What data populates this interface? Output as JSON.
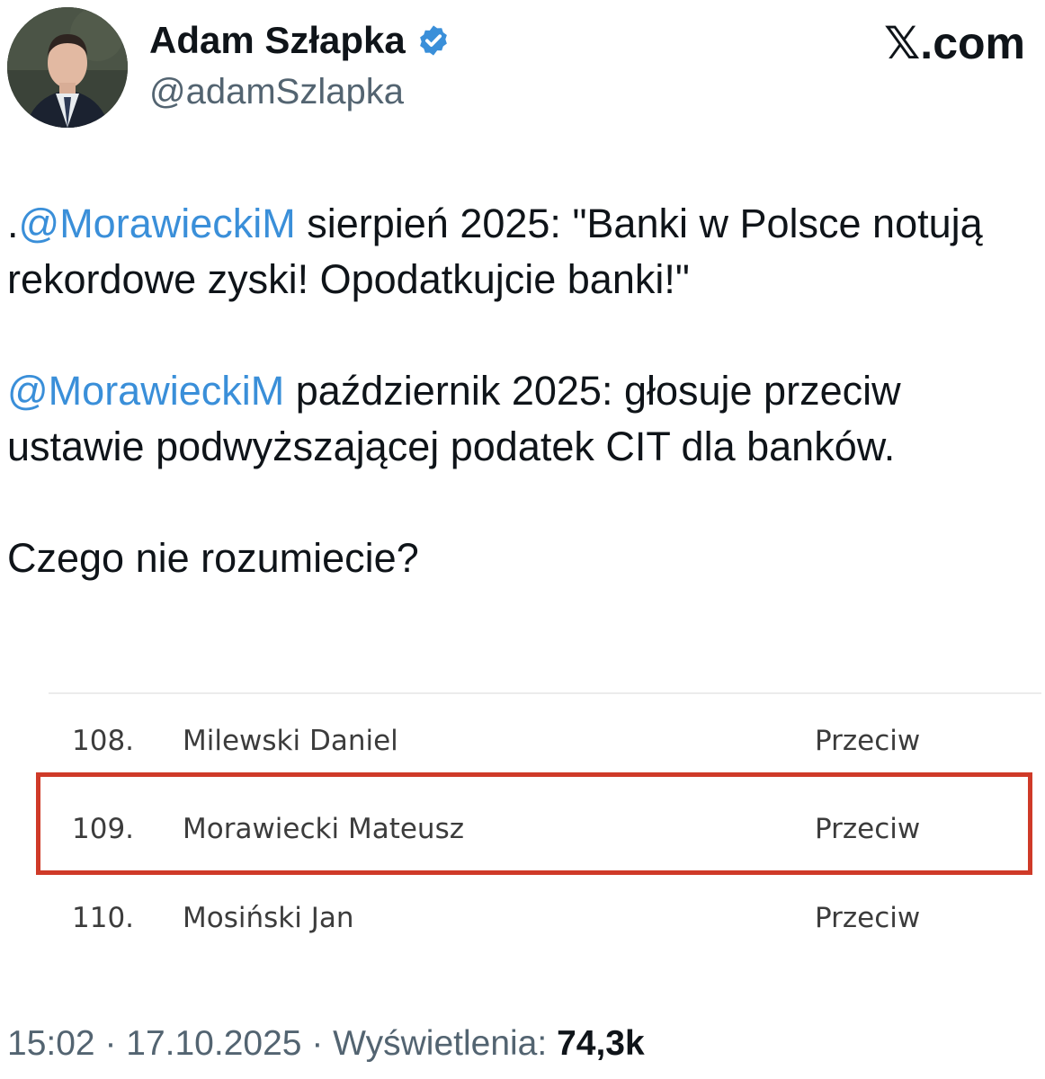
{
  "author": {
    "display_name": "Adam Szłapka",
    "handle": "@adamSzlapka",
    "verified": true,
    "avatar": "profile-photo"
  },
  "site_label": "𝕏.com",
  "tweet": {
    "paragraphs": [
      {
        "prefix": ".",
        "mention": "@MorawieckiM",
        "text": " sierpień 2025: \"Banki w Polsce notują rekordowe zyski! Opodatkujcie banki!\""
      },
      {
        "prefix": "",
        "mention": "@MorawieckiM",
        "text": " październik 2025: głosuje przeciw ustawie podwyższającej podatek CIT dla banków."
      },
      {
        "prefix": "",
        "mention": "",
        "text": "Czego nie rozumiecie?"
      }
    ]
  },
  "vote_table": {
    "rows": [
      {
        "num": "108.",
        "name": "Milewski Daniel",
        "vote": "Przeciw"
      },
      {
        "num": "109.",
        "name": "Morawiecki Mateusz",
        "vote": "Przeciw"
      },
      {
        "num": "110.",
        "name": "Mosiński Jan",
        "vote": "Przeciw"
      }
    ],
    "highlight_color": "#cf3a28"
  },
  "meta": {
    "time": "15:02",
    "separator": " · ",
    "date": "17.10.2025",
    "views_label": "Wyświetlenia: ",
    "views_count": "74,3k"
  },
  "colors": {
    "mention": "#3a8fd9",
    "verified_badge": "#3a8fd9",
    "secondary_text": "#536471"
  }
}
